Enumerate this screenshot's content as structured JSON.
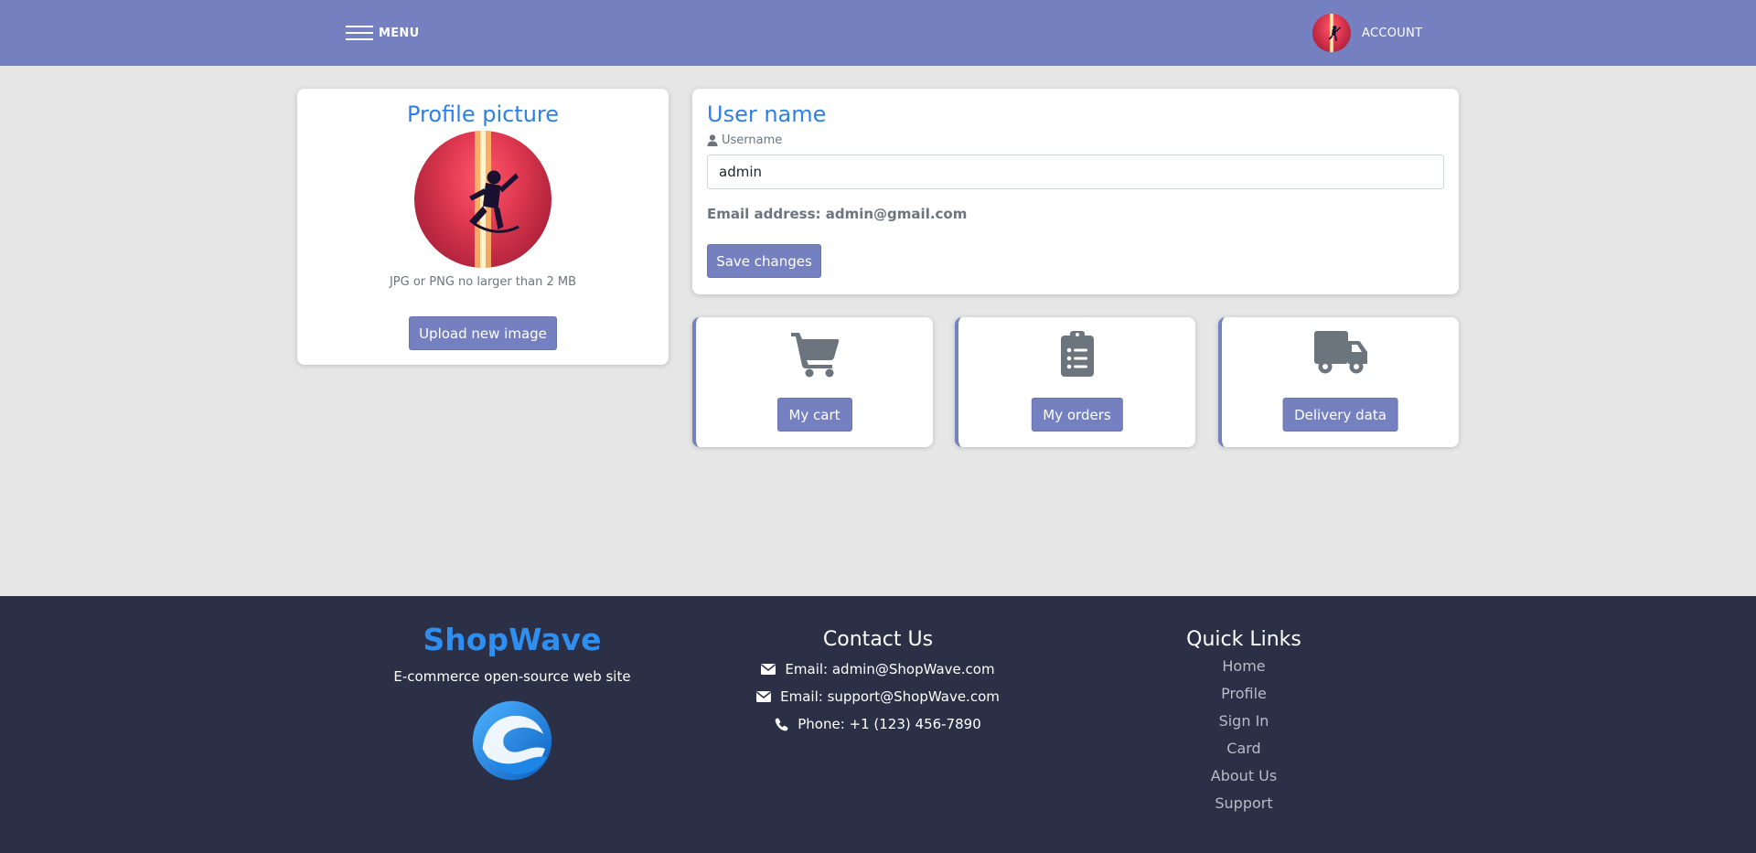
{
  "header": {
    "menu_label": "MENU",
    "account_label": "ACCOUNT",
    "bg_color": "#7480bf"
  },
  "profile_card": {
    "title": "Profile picture",
    "hint": "JPG or PNG no larger than 2 MB",
    "upload_label": "Upload new image"
  },
  "user_card": {
    "title": "User name",
    "field_label": "Username",
    "username_value": "admin",
    "email_text": "Email address: admin@gmail.com",
    "save_label": "Save changes"
  },
  "tiles": [
    {
      "icon": "cart-icon",
      "label": "My cart"
    },
    {
      "icon": "clipboard-list-icon",
      "label": "My orders"
    },
    {
      "icon": "truck-icon",
      "label": "Delivery data"
    }
  ],
  "footer": {
    "brand_name": "ShopWave",
    "brand_tagline": "E-commerce open-source web site",
    "contact_title": "Contact Us",
    "contact": [
      {
        "icon": "envelope-icon",
        "text": "Email: admin@ShopWave.com"
      },
      {
        "icon": "envelope-icon",
        "text": "Email: support@ShopWave.com"
      },
      {
        "icon": "phone-icon",
        "text": "Phone: +1 (123) 456-7890"
      }
    ],
    "links_title": "Quick Links",
    "links": [
      "Home",
      "Profile",
      "Sign In",
      "Card",
      "About Us",
      "Support"
    ],
    "bg_color": "#2b3046",
    "brand_color": "#2f8ff0"
  },
  "colors": {
    "accent": "#7480bf",
    "title_blue": "#2f7fe8",
    "page_bg": "#e6e6e6"
  }
}
